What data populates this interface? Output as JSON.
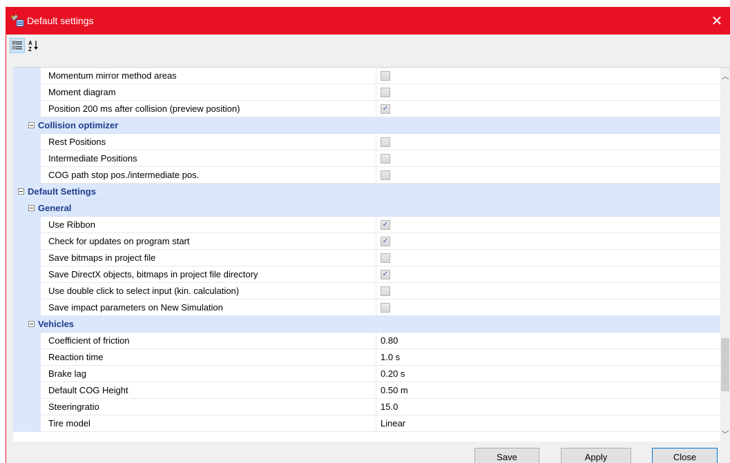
{
  "window": {
    "title": "Default settings"
  },
  "colors": {
    "titlebar": "#e81123",
    "category_bg": "#dbe7fb",
    "category_text": "#1e3e8c"
  },
  "toolbar": {
    "categorized_icon": "categorized-icon",
    "alphabetical_icon": "sort-alphabetical-icon"
  },
  "grid": {
    "rows": [
      {
        "kind": "item",
        "level": 2,
        "label": "Momentum mirror method areas",
        "checkbox": true,
        "checked": false
      },
      {
        "kind": "item",
        "level": 2,
        "label": "Moment diagram",
        "checkbox": true,
        "checked": false
      },
      {
        "kind": "item",
        "level": 2,
        "label": "Position 200 ms after collision (preview position)",
        "checkbox": true,
        "checked": true
      },
      {
        "kind": "cat",
        "level": 1,
        "label": "Collision optimizer"
      },
      {
        "kind": "item",
        "level": 2,
        "label": "Rest Positions",
        "checkbox": true,
        "checked": false
      },
      {
        "kind": "item",
        "level": 2,
        "label": "Intermediate Positions",
        "checkbox": true,
        "checked": false
      },
      {
        "kind": "item",
        "level": 2,
        "label": "COG path stop pos./intermediate pos.",
        "checkbox": true,
        "checked": false
      },
      {
        "kind": "cat",
        "level": 0,
        "label": "Default Settings"
      },
      {
        "kind": "cat",
        "level": 1,
        "label": "General"
      },
      {
        "kind": "item",
        "level": 2,
        "label": "Use Ribbon",
        "checkbox": true,
        "checked": true
      },
      {
        "kind": "item",
        "level": 2,
        "label": "Check for updates on program start",
        "checkbox": true,
        "checked": true
      },
      {
        "kind": "item",
        "level": 2,
        "label": "Save bitmaps in project file",
        "checkbox": true,
        "checked": false
      },
      {
        "kind": "item",
        "level": 2,
        "label": "Save DirectX objects, bitmaps in project file directory",
        "checkbox": true,
        "checked": true
      },
      {
        "kind": "item",
        "level": 2,
        "label": "Use double click to select input (kin. calculation)",
        "checkbox": true,
        "checked": false
      },
      {
        "kind": "item",
        "level": 2,
        "label": "Save impact parameters on New Simulation",
        "checkbox": true,
        "checked": false
      },
      {
        "kind": "cat",
        "level": 1,
        "label": "Vehicles"
      },
      {
        "kind": "item",
        "level": 2,
        "label": "Coefficient of friction",
        "value": "0.80"
      },
      {
        "kind": "item",
        "level": 2,
        "label": "Reaction time",
        "value": "1.0 s"
      },
      {
        "kind": "item",
        "level": 2,
        "label": "Brake lag",
        "value": "0.20 s"
      },
      {
        "kind": "item",
        "level": 2,
        "label": "Default COG Height",
        "value": "0.50 m"
      },
      {
        "kind": "item",
        "level": 2,
        "label": "Steeringratio",
        "value": "15.0"
      },
      {
        "kind": "item",
        "level": 2,
        "label": "Tire model",
        "value": "Linear"
      }
    ]
  },
  "buttons": {
    "save": "Save",
    "apply": "Apply",
    "close": "Close"
  }
}
